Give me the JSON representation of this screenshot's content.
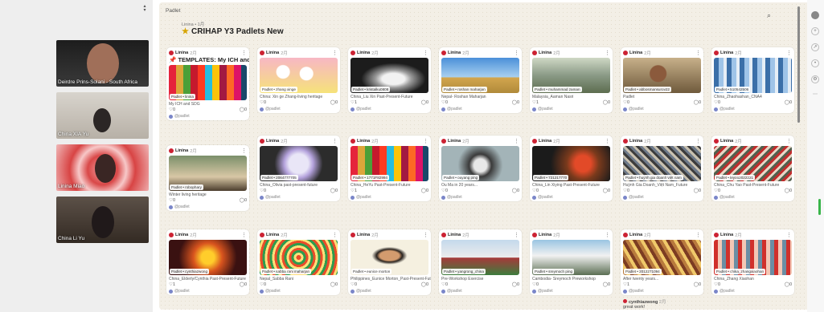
{
  "video": {
    "participants": [
      {
        "name": "Deirdre Prins-Solani - South Africa"
      },
      {
        "name": "China XIA Yu"
      },
      {
        "name": "Linina Miao"
      },
      {
        "name": "China Li Yu"
      }
    ]
  },
  "padlet": {
    "tab": "Padlet",
    "owner": "Linina • 1月",
    "title": "CRIHAP Y3 Padlets New"
  },
  "common": {
    "author": "Linina",
    "time": "2月",
    "poster": "@padlet",
    "comments": "0"
  },
  "cards": [
    {
      "title": "TEMPLATES: My ICH and SDG",
      "attr": "Padlet • linina",
      "sub": "My ICH and SDG",
      "likes": "0",
      "img": "sdg"
    },
    {
      "title": "",
      "attr": "Padlet • zhang xinge",
      "sub": "China: Xin ge Zhang-living heritage",
      "likes": "0",
      "img": "cartoon"
    },
    {
      "title": "",
      "attr": "Padlet • kristalku0808",
      "sub": "China_Liu Xin Past-Present-Future",
      "likes": "1",
      "img": "dress"
    },
    {
      "title": "",
      "attr": "Padlet • roshan maharjan",
      "sub": "Nepal- Roshan Maharjan",
      "likes": "0",
      "img": "plane"
    },
    {
      "title": "",
      "attr": "Padlet • muhammad zaman",
      "sub": "Malaysia_Aaman Nasri",
      "likes": "1",
      "img": "temerloh"
    },
    {
      "title": "",
      "attr": "Padlet • abbosmansurov22",
      "sub": "Padlet",
      "likes": "0",
      "img": "man"
    },
    {
      "title": "",
      "attr": "Padlet • 510542506",
      "sub": "China_Zhaohashan_CNA4",
      "likes": "0",
      "img": "fabric"
    },
    {
      "title": "",
      "attr": "Padlet • robophary",
      "sub": "Winter living heritage",
      "likes": "0",
      "img": "people"
    },
    {
      "title": "",
      "attr": "Padlet • 2064777705",
      "sub": "China_Olivia past-present-future",
      "likes": "0",
      "img": "flower"
    },
    {
      "title": "",
      "attr": "Padlet • 1771F82994",
      "sub": "China_HeYu Past-Present-Future",
      "likes": "1",
      "img": "sdg"
    },
    {
      "title": "",
      "attr": "Padlet • ouyang ping",
      "sub": "Ou Ma in 20 years...",
      "likes": "0",
      "img": "cat"
    },
    {
      "title": "",
      "attr": "Padlet • 721217770",
      "sub": "China_Lin Xiying Past-Present-Future",
      "likes": "0",
      "img": "mask"
    },
    {
      "title": "",
      "attr": "Padlet • huỳnh gia doanh việt nam",
      "sub": "Huỳnh Gia Doanh_Việt Nam_Future",
      "likes": "0",
      "img": "crowd"
    },
    {
      "title": "",
      "attr": "Padlet • leyoo2022221",
      "sub": "China_Chu Yao Past-Present-Future",
      "likes": "0",
      "img": "crowd2"
    },
    {
      "title": "",
      "attr": "Padlet • cynthiazwong",
      "sub": "China_Elderly/Cynthia Past-Present-Future",
      "likes": "1",
      "img": "lantern"
    },
    {
      "title": "",
      "attr": "Padlet • sabba rani maharjan",
      "sub": "Nepal_Sabba Rani",
      "likes": "0",
      "img": "ornament"
    },
    {
      "title": "",
      "attr": "Padlet • eunice morton",
      "sub": "Philippines_Eunice Morton_Past-Present-Future",
      "likes": "0",
      "img": "face"
    },
    {
      "title": "",
      "attr": "Padlet • yangrong_china",
      "sub": "Pre-Workshop Exercise",
      "likes": "0",
      "img": "dance"
    },
    {
      "title": "",
      "attr": "Padlet • sreymoch ping",
      "sub": "Cambodia- Sreymoch Preworkshop",
      "likes": "0",
      "img": "temple"
    },
    {
      "title": "",
      "attr": "Padlet • 2012271094",
      "sub": "After twenty years...",
      "likes": "1",
      "img": "market"
    },
    {
      "title": "",
      "attr": "Padlet • chika_zhangxiaohan",
      "sub": "China_Zhang Xiaohan",
      "likes": "0",
      "img": "festival"
    }
  ],
  "extra": {
    "name": "cynthiazwong",
    "time": "2月",
    "text": "great work!"
  },
  "colors": {
    "accent": "#c23b3b",
    "bg": "#f3efe6"
  }
}
